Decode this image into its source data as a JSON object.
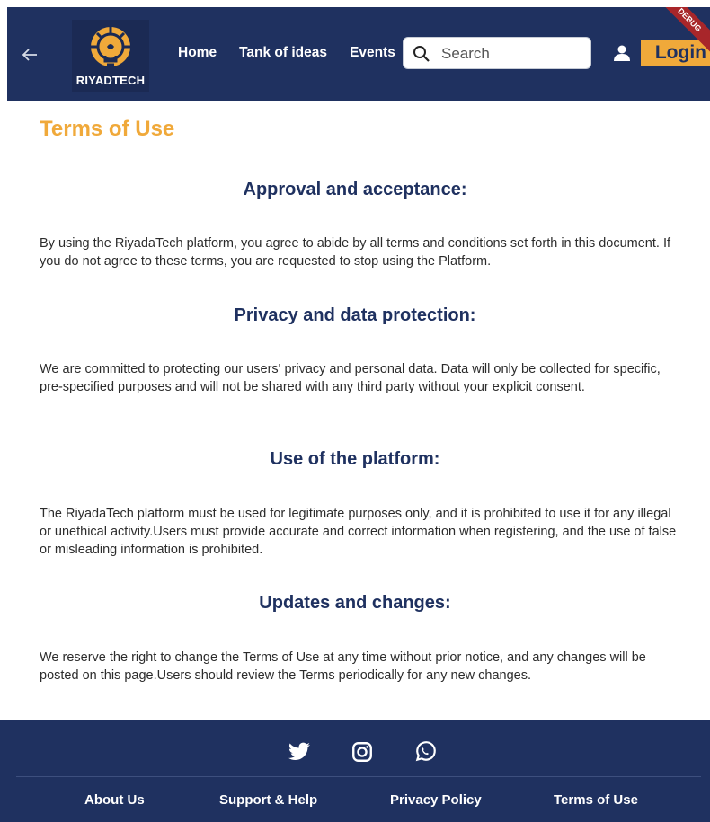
{
  "header": {
    "logo_text": "RIYADTECH",
    "nav": [
      "Home",
      "Tank of ideas",
      "Events"
    ],
    "search_placeholder": "Search",
    "login_label": "Login",
    "debug_banner": "DEBUG"
  },
  "page": {
    "title": "Terms of Use",
    "sections": [
      {
        "heading": "Approval and acceptance:",
        "body": "By using the RiyadaTech platform, you agree to abide by all terms and conditions set forth in this document. If you do not agree to these terms, you are requested to stop using the Platform."
      },
      {
        "heading": "Privacy and data protection:",
        "body": "We are committed to protecting our users' privacy and personal data. Data will only be collected for specific, pre-specified purposes and will not be shared with any third party without your explicit consent."
      },
      {
        "heading": "Use of the platform:",
        "body": "The RiyadaTech platform must be used for legitimate purposes only, and it is prohibited to use it for any illegal or unethical activity.Users must provide accurate and correct information when registering, and the use of false or misleading information is prohibited."
      },
      {
        "heading": "Updates and changes:",
        "body": "We reserve the right to change the Terms of Use at any time without prior notice, and any changes will be posted on this page.Users should review the Terms periodically for any new changes."
      }
    ]
  },
  "footer": {
    "socials": [
      "twitter-icon",
      "instagram-icon",
      "whatsapp-icon"
    ],
    "links": [
      "About Us",
      "Support & Help",
      "Privacy Policy",
      "Terms of Use"
    ]
  },
  "colors": {
    "navy": "#1f3160",
    "accent": "#f0a93a",
    "debug": "#a8262a"
  }
}
